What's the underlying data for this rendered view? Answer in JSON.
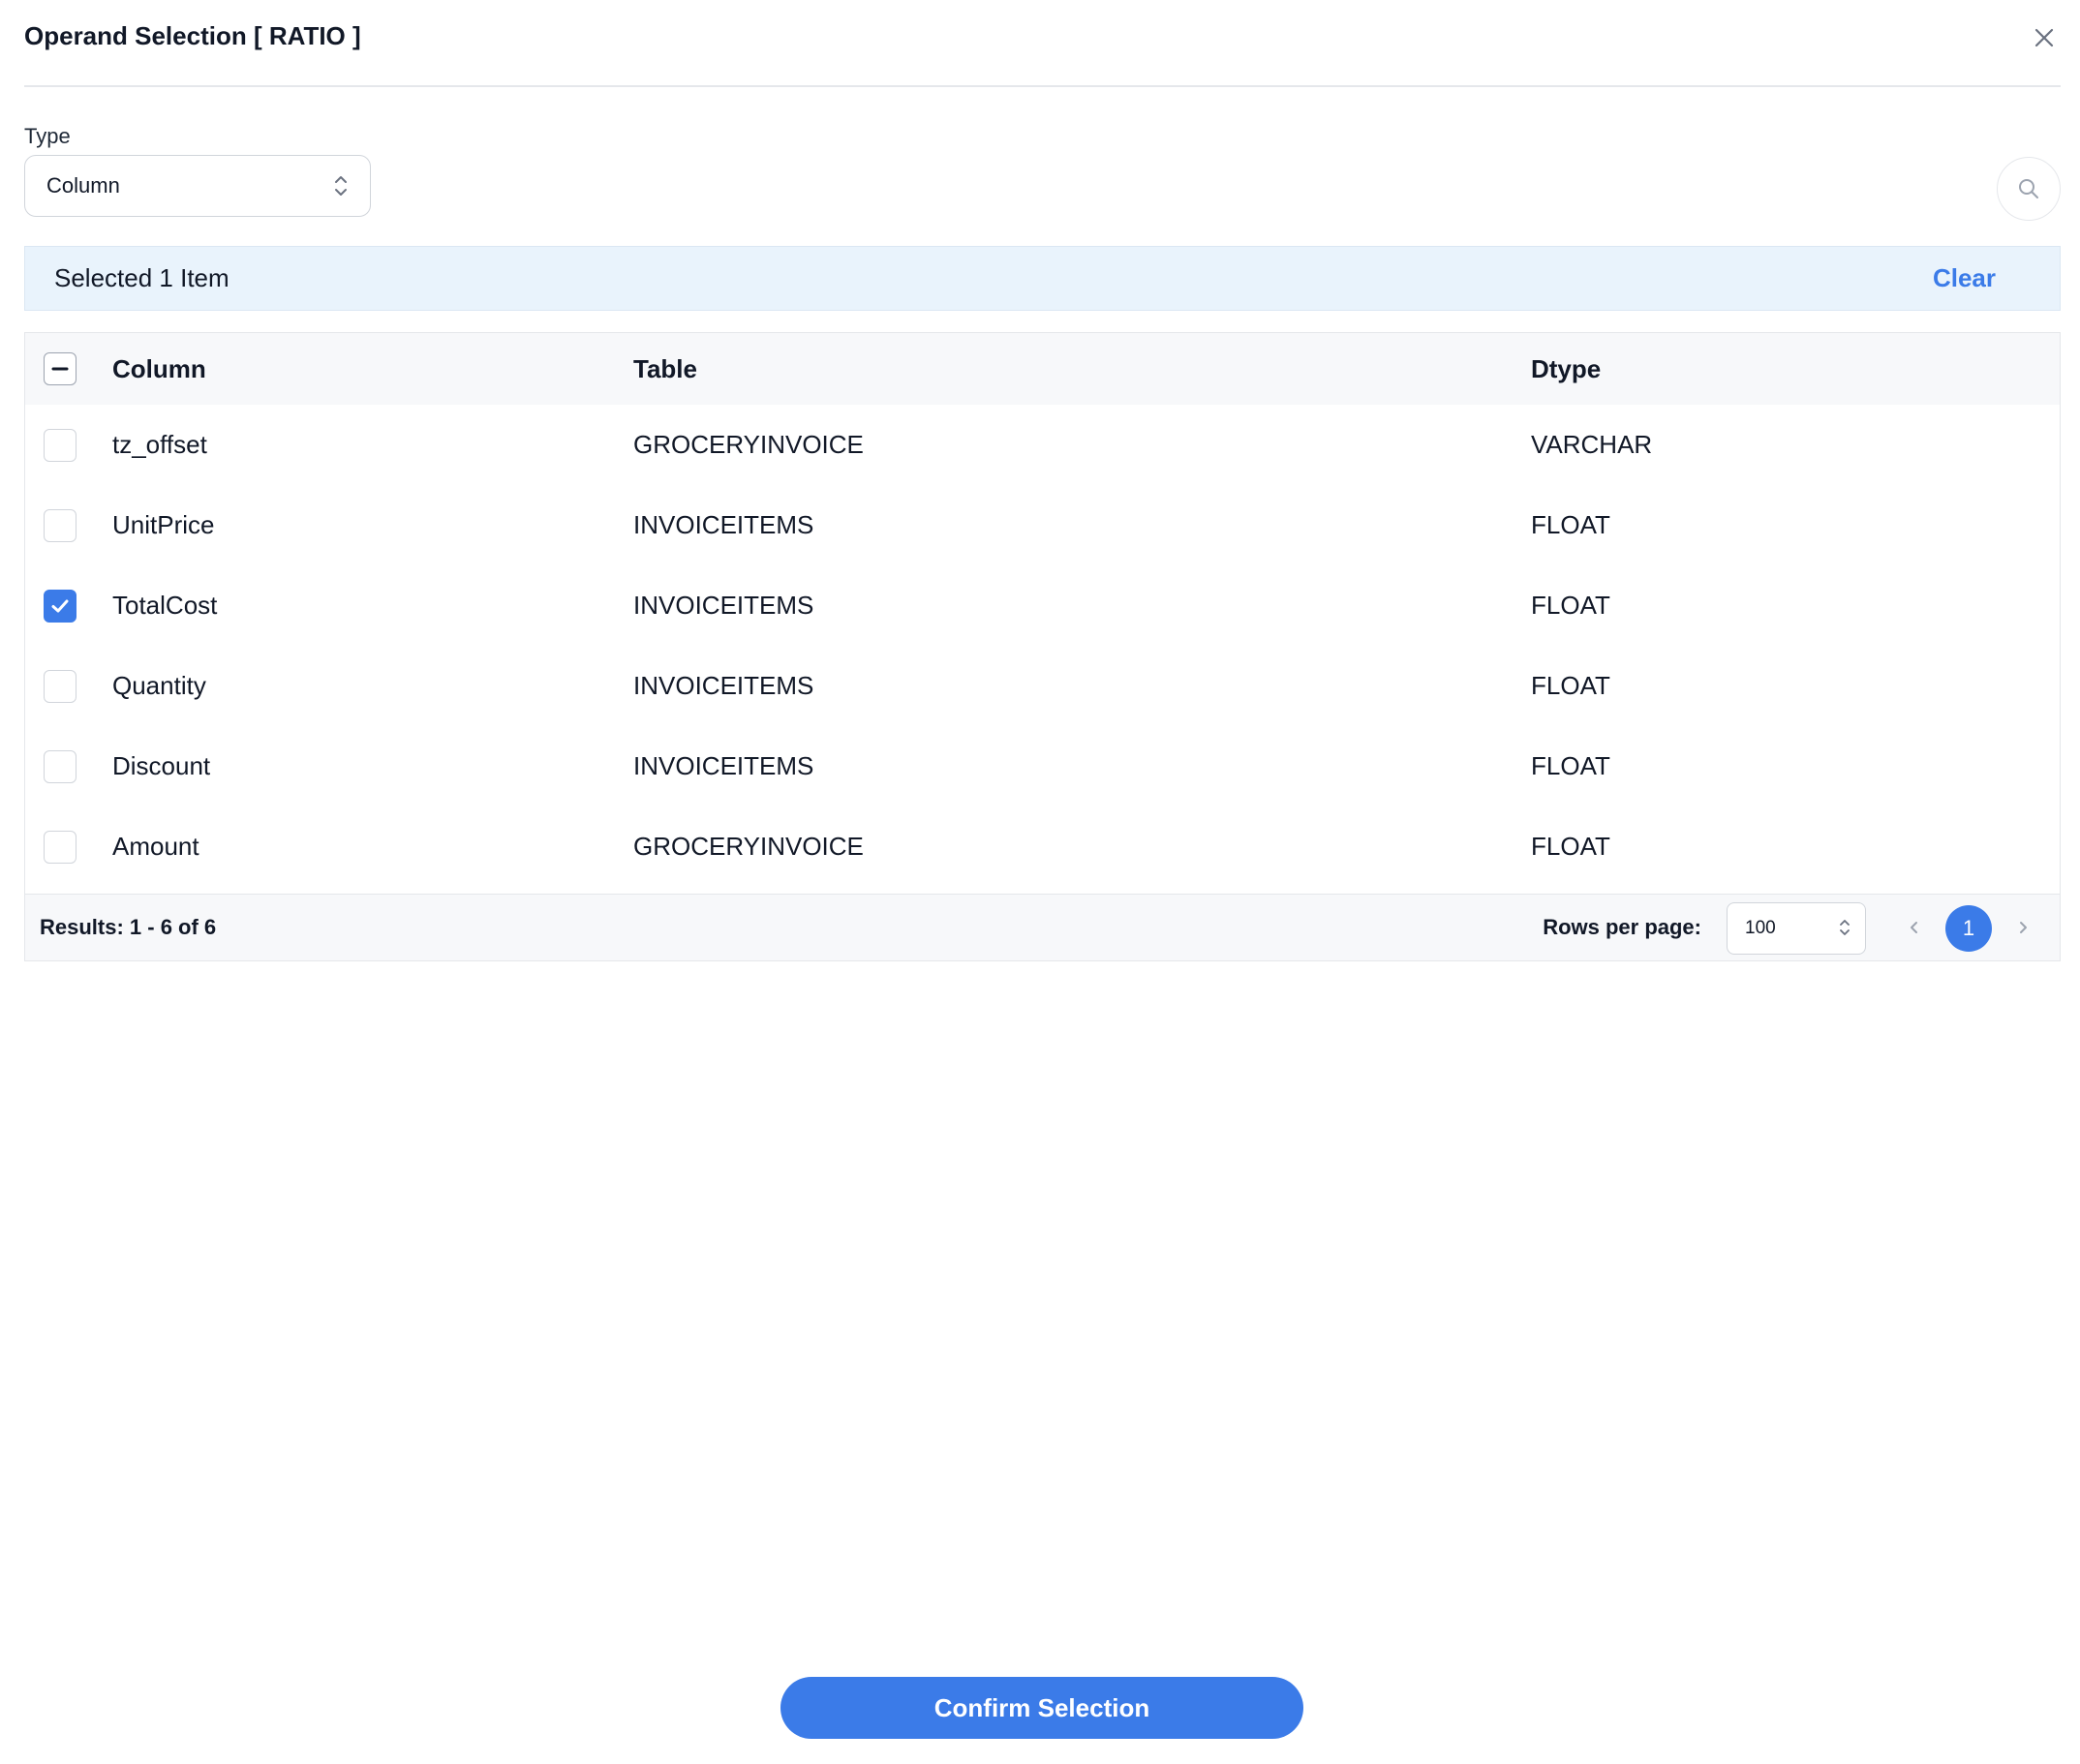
{
  "dialog": {
    "title": "Operand Selection [ RATIO ]"
  },
  "type_filter": {
    "label": "Type",
    "selected": "Column"
  },
  "selection_bar": {
    "text": "Selected 1 Item",
    "clear_label": "Clear"
  },
  "table": {
    "headers": {
      "column": "Column",
      "table": "Table",
      "dtype": "Dtype"
    },
    "rows": [
      {
        "column": "tz_offset",
        "table": "GROCERYINVOICE",
        "dtype": "VARCHAR",
        "checked": false
      },
      {
        "column": "UnitPrice",
        "table": "INVOICEITEMS",
        "dtype": "FLOAT",
        "checked": false
      },
      {
        "column": "TotalCost",
        "table": "INVOICEITEMS",
        "dtype": "FLOAT",
        "checked": true
      },
      {
        "column": "Quantity",
        "table": "INVOICEITEMS",
        "dtype": "FLOAT",
        "checked": false
      },
      {
        "column": "Discount",
        "table": "INVOICEITEMS",
        "dtype": "FLOAT",
        "checked": false
      },
      {
        "column": "Amount",
        "table": "GROCERYINVOICE",
        "dtype": "FLOAT",
        "checked": false
      }
    ]
  },
  "pagination": {
    "results_text": "Results: 1 - 6 of 6",
    "rows_per_page_label": "Rows per page:",
    "rows_per_page": "100",
    "current_page": "1"
  },
  "footer": {
    "confirm_label": "Confirm Selection"
  },
  "colors": {
    "accent": "#3b7be8",
    "selection_bar_bg": "#e9f3fc",
    "header_bg": "#f7f8fa"
  }
}
